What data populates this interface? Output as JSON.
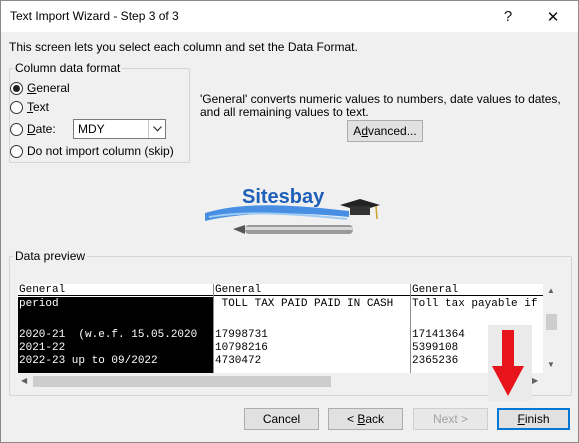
{
  "window": {
    "title": "Text Import Wizard - Step 3 of 3",
    "help_glyph": "?",
    "close_glyph": "✕"
  },
  "description": "This screen lets you select each column and set the Data Format.",
  "column_format": {
    "legend": "Column data format",
    "options": [
      {
        "label": "General",
        "accel": "G",
        "rest": "eneral",
        "checked": true
      },
      {
        "label": "Text",
        "accel": "T",
        "rest": "ext",
        "checked": false
      },
      {
        "label": "Date:",
        "accel": "D",
        "rest": "ate:",
        "checked": false
      },
      {
        "label": "Do not import column (skip)",
        "accel": "",
        "rest": "Do not import column (skip)",
        "checked": false
      }
    ],
    "date_format": "MDY"
  },
  "info_text": "'General' converts numeric values to numbers, date values to dates, and all remaining values to text.",
  "advanced_button": {
    "pre": "A",
    "accel": "d",
    "post": "vanced..."
  },
  "logo_text": "Sitesbay",
  "preview": {
    "legend": "Data preview",
    "columns": [
      {
        "header": "General",
        "rows": [
          "period",
          "",
          "2020-21  (w.e.f. 15.05.2020",
          "2021-22",
          "2022-23 up to 09/2022"
        ]
      },
      {
        "header": "General",
        "rows": [
          " TOLL TAX PAID PAID IN CASH",
          "",
          "17998731",
          "10798216",
          "4730472"
        ]
      },
      {
        "header": "General",
        "rows": [
          "Toll tax payable if",
          "",
          "17141364",
          "5399108",
          "2365236"
        ]
      }
    ]
  },
  "buttons": {
    "cancel": "Cancel",
    "back_accel": "B",
    "back_rest": "ack",
    "back_prefix": "< ",
    "next": "Next >",
    "finish_accel": "F",
    "finish_rest": "inish"
  },
  "colors": {
    "accent": "#0078d7",
    "annotation_arrow": "#e8141c",
    "selected_column": "#000000"
  },
  "icons": [
    "help-icon",
    "close-icon",
    "chevron-down-icon",
    "scroll-up-icon",
    "scroll-down-icon",
    "scroll-left-icon",
    "scroll-right-icon",
    "red-arrow-annotation"
  ]
}
